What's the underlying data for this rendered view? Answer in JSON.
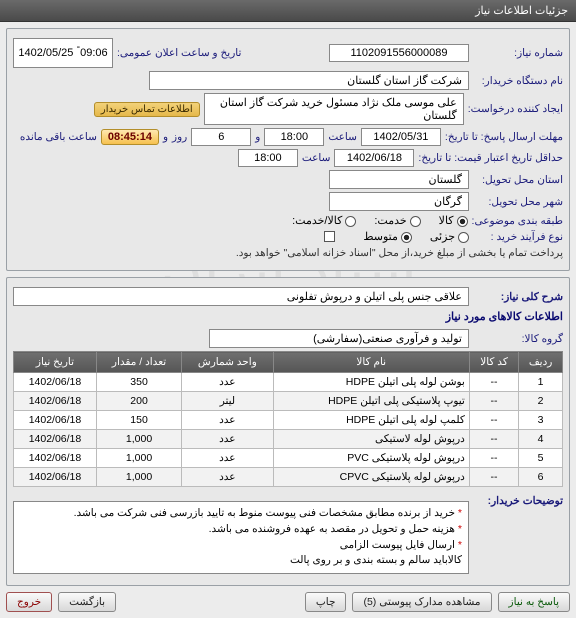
{
  "window_title": "جزئیات اطلاعات نیاز",
  "watermark_line1": "ستاد ایران",
  "watermark_line2": "۰۲۱-۸۸۳۴۵۹۰۹",
  "header": {
    "labels": {
      "need_no": "شماره نیاز:",
      "announce_dt": "تاریخ و ساعت اعلان عمومی:",
      "buyer_org": "نام دستگاه خریدار:",
      "requester": "ایجاد کننده درخواست:",
      "contact_chip": "اطلاعات تماس خریدار",
      "reply_deadline": "مهلت ارسال پاسخ: تا تاریخ:",
      "hour": "ساعت",
      "and": "و",
      "day": "روز",
      "remaining": "ساعت باقی مانده",
      "validity": "حداقل تاریخ اعتبار قیمت: تا تاریخ:",
      "province": "استان محل تحویل:",
      "city": "شهر محل تحویل:",
      "service": "خدمت:",
      "goods_svc": "کالا/خدمت:",
      "goods": "کالا",
      "class": "طبقه بندی موضوعی:",
      "proc_type": "نوع فرآیند خرید :",
      "proc_joint": "جزئی",
      "proc_mid": "متوسط",
      "pay_note": "پرداخت تمام یا بخشی از مبلغ خرید،از محل \"اسناد خزانه اسلامی\" خواهد بود."
    },
    "values": {
      "need_no": "1102091556000089",
      "announce_date": "1402/05/25",
      "announce_time": "09:06",
      "buyer_org": "شرکت گاز استان گلستان",
      "requester": "علی موسی ملک نژاد مسئول خرید شرکت گاز استان گلستان",
      "reply_date": "1402/05/31",
      "reply_time": "18:00",
      "remaining_days": "6",
      "countdown": "08:45:14",
      "validity_date": "1402/06/18",
      "validity_time": "18:00",
      "province": "گلستان",
      "city": "گرگان"
    }
  },
  "summary": {
    "labels": {
      "title": "شرح کلی نیاز:",
      "items_section": "اطلاعات کالاهای مورد نیاز",
      "goods_group": "گروه کالا:",
      "group_value": "تولید و فرآوری صنعتی(سفارشی)"
    },
    "need_desc": "علاقی جنس پلی اتیلن و درپوش تفلونی"
  },
  "table": {
    "headers": {
      "row": "ردیف",
      "code": "کد کالا",
      "name": "نام کالا",
      "unit": "واحد شمارش",
      "qty": "تعداد / مقدار",
      "date": "تاریخ نیاز"
    },
    "rows": [
      {
        "idx": "1",
        "code": "--",
        "name": "بوشن لوله پلی اتیلن HDPE",
        "unit": "عدد",
        "qty": "350",
        "date": "1402/06/18"
      },
      {
        "idx": "2",
        "code": "--",
        "name": "تیوپ پلاستیکی پلی اتیلن HDPE",
        "unit": "لیتر",
        "qty": "200",
        "date": "1402/06/18"
      },
      {
        "idx": "3",
        "code": "--",
        "name": "کلمپ لوله پلی اتیلن HDPE",
        "unit": "عدد",
        "qty": "150",
        "date": "1402/06/18"
      },
      {
        "idx": "4",
        "code": "--",
        "name": "درپوش لوله لاستیکی",
        "unit": "عدد",
        "qty": "1,000",
        "date": "1402/06/18"
      },
      {
        "idx": "5",
        "code": "--",
        "name": "درپوش لوله پلاستیکی PVC",
        "unit": "عدد",
        "qty": "1,000",
        "date": "1402/06/18"
      },
      {
        "idx": "6",
        "code": "--",
        "name": "درپوش لوله پلاستیکی CPVC",
        "unit": "عدد",
        "qty": "1,000",
        "date": "1402/06/18"
      }
    ]
  },
  "notes": {
    "label": "توضیحات خریدار:",
    "lines": [
      "خرید از برنده مطابق مشخصات فنی پیوست منوط به تایید بازرسی فنی شرکت می باشد.",
      "هزینه حمل و تحویل در مقصد به عهده فروشنده می باشد.",
      "ارسال فایل پیوست الزامی",
      "کالاباید سالم و بسته بندی و بر روی پالت"
    ]
  },
  "footer": {
    "reply": "پاسخ به نیاز",
    "attachments": "مشاهده مدارک پیوستی (5)",
    "print": "چاپ",
    "back": "بازگشت",
    "exit": "خروج"
  }
}
